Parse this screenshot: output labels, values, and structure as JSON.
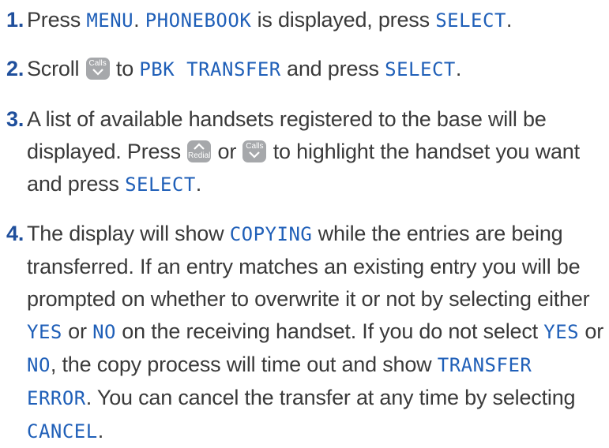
{
  "keys": {
    "calls": {
      "label": "Calls",
      "icon": "chevron-down-icon"
    },
    "redial": {
      "label": "Redial",
      "icon": "chevron-up-icon"
    }
  },
  "colors": {
    "step_number": "#1f4f9c",
    "display_text": "#1f5fb8",
    "body_text": "#3a3a3a",
    "key_background": "#a6a8ab"
  },
  "steps": [
    {
      "number": "1.",
      "parts": [
        "Press ",
        "MENU",
        ". ",
        "PHONEBOOK",
        " is displayed, press ",
        "SELECT",
        "."
      ]
    },
    {
      "number": "2.",
      "parts": [
        "Scroll ",
        " to ",
        "PBK TRANSFER",
        " and press ",
        "SELECT",
        "."
      ]
    },
    {
      "number": "3.",
      "parts": [
        "A list of available handsets registered to the base will be displayed. Press ",
        " or ",
        " to highlight the handset you want and press ",
        "SELECT",
        "."
      ]
    },
    {
      "number": "4.",
      "parts": [
        "The display will show ",
        "COPYING",
        " while the entries are being transferred. If an entry matches an existing entry you will be prompted on whether to overwrite it or not by selecting either ",
        "YES",
        " or ",
        "NO",
        " on the receiving handset. If you do not select ",
        "YES",
        " or ",
        "NO",
        ", the copy process will time out and show ",
        "TRANSFER ERROR",
        ". You can cancel the transfer at any time by selecting ",
        "CANCEL",
        "."
      ]
    }
  ]
}
